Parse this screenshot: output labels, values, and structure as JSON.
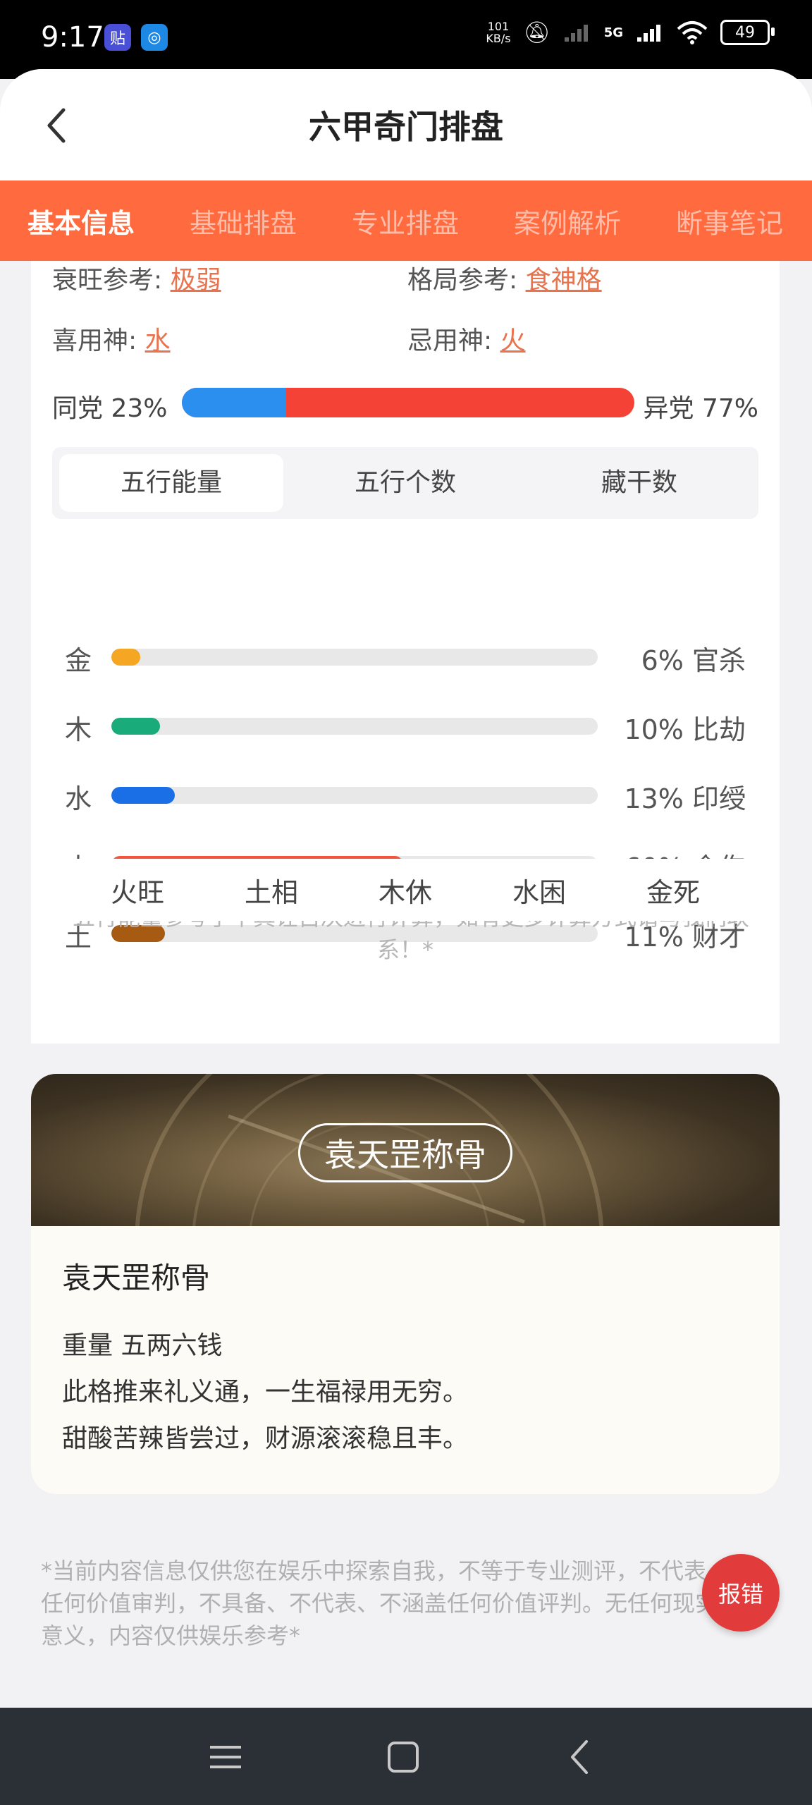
{
  "status_bar": {
    "time": "9:17",
    "app_icon_1": "贴",
    "app_icon_2": "◎",
    "net_speed_value": "101",
    "net_speed_unit": "KB/s",
    "network": "5G",
    "battery": "49"
  },
  "header": {
    "title": "六甲奇门排盘"
  },
  "tabs": [
    {
      "label": "基本信息"
    },
    {
      "label": "基础排盘"
    },
    {
      "label": "专业排盘"
    },
    {
      "label": "案例解析"
    },
    {
      "label": "断事笔记"
    }
  ],
  "reference": {
    "strength_label": "衰旺参考:",
    "strength_value": "极弱",
    "pattern_label": "格局参考:",
    "pattern_value": "食神格",
    "favorable_label": "喜用神:",
    "favorable_value": "水",
    "unfavorable_label": "忌用神:",
    "unfavorable_value": "火"
  },
  "party": {
    "same_label": "同党 23%",
    "diff_label": "异党 77%",
    "same_fraction": 0.23
  },
  "segments": [
    {
      "label": "五行能量"
    },
    {
      "label": "五行个数"
    },
    {
      "label": "藏干数"
    }
  ],
  "elements": [
    {
      "name": "金",
      "pct_text": "6% 官杀",
      "fraction": 0.06,
      "color": "#f5a623"
    },
    {
      "name": "木",
      "pct_text": "10% 比劫",
      "fraction": 0.1,
      "color": "#1aab7a"
    },
    {
      "name": "水",
      "pct_text": "13% 印绶",
      "fraction": 0.13,
      "color": "#1b6fe6"
    },
    {
      "name": "火",
      "pct_text": "60% 食伤",
      "fraction": 0.6,
      "color": "#f4533c"
    },
    {
      "name": "土",
      "pct_text": "11% 财才",
      "fraction": 0.11,
      "color": "#a65a12"
    }
  ],
  "note": "*五行能量参考子平真诠古决进行计算，如有更多计算方式请与我们联系！*",
  "seasons": [
    "火旺",
    "土相",
    "木休",
    "水困",
    "金死"
  ],
  "bone": {
    "banner_title": "袁天罡称骨",
    "title": "袁天罡称骨",
    "weight": "重量  五两六钱",
    "line1": "此格推来礼义通，一生福禄用无穷。",
    "line2": "甜酸苦辣皆尝过，财源滚滚稳且丰。"
  },
  "disclaimer": "*当前内容信息仅供您在娱乐中探索自我，不等于专业测评，不代表任何价值审判，不具备、不代表、不涵盖任何价值评判。无任何现实意义，内容仅供娱乐参考*",
  "report_button": "报错",
  "colors": {
    "accent": "#ff6b3f",
    "link": "#e8744f",
    "same_party": "#2b8ff0",
    "diff_party": "#f44336"
  }
}
